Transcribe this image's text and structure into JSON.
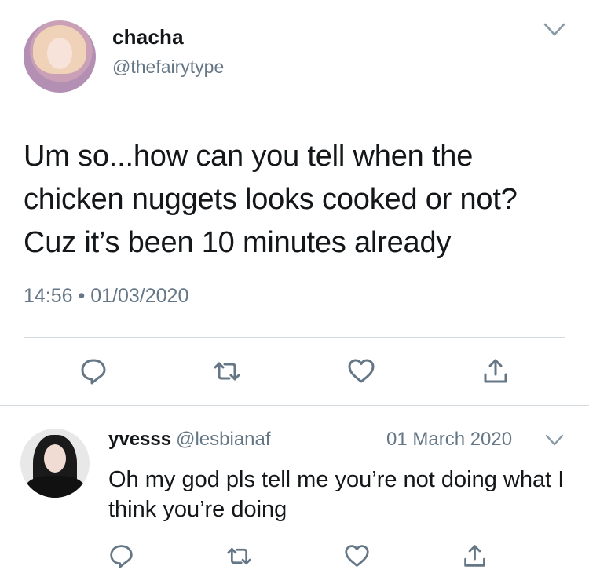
{
  "tweet": {
    "author": {
      "display_name": "chacha",
      "handle": "@thefairytype"
    },
    "text": "Um so...how can you tell when the chicken nuggets looks cooked or not? Cuz it’s been 10 minutes already",
    "time": "14:56",
    "separator": "•",
    "date": "01/03/2020"
  },
  "reply": {
    "author": {
      "display_name": "yvesss",
      "handle": "@lesbianaf"
    },
    "date": "01 March 2020",
    "text": "Oh my god pls tell me you’re not doing what I think you’re doing"
  },
  "icons": {
    "reply": "reply-icon",
    "retweet": "retweet-icon",
    "like": "heart-icon",
    "share": "share-icon",
    "menu": "chevron-down-icon"
  },
  "colors": {
    "text": "#14171a",
    "secondary": "#657786",
    "icon": "#657786",
    "divider": "#d6dbe0"
  }
}
